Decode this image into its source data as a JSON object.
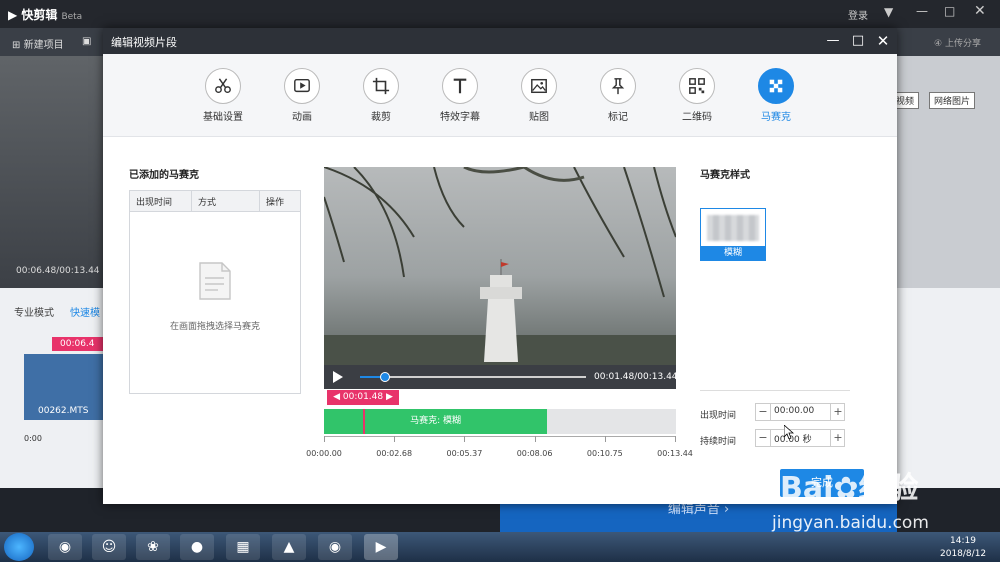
{
  "app": {
    "name": "快剪辑",
    "edition": "Beta",
    "login_label": "登录",
    "new_project_label": "新建项目",
    "upload_share_label": "上传分享",
    "preview_time": "00:06.48/00:13.44",
    "pro_mode_label": "专业模式",
    "quick_mode_label": "快速模",
    "clip_name": "00262.MTS",
    "clip_time": "00:06.4",
    "ruler_start": "0:00",
    "right_btn_1": "视频",
    "right_btn_2": "网络图片",
    "bottom_button_label": "编辑声音"
  },
  "modal": {
    "title": "编辑视频片段",
    "tools": [
      {
        "name": "basic",
        "label": "基础设置",
        "icon": "scissors-icon"
      },
      {
        "name": "animation",
        "label": "动画",
        "icon": "play-box-icon"
      },
      {
        "name": "crop",
        "label": "裁剪",
        "icon": "crop-icon"
      },
      {
        "name": "subtitle",
        "label": "特效字幕",
        "icon": "text-icon"
      },
      {
        "name": "sticker",
        "label": "贴图",
        "icon": "image-icon"
      },
      {
        "name": "mark",
        "label": "标记",
        "icon": "pin-icon"
      },
      {
        "name": "qrcode",
        "label": "二维码",
        "icon": "qrcode-icon"
      },
      {
        "name": "mosaic",
        "label": "马赛克",
        "icon": "mosaic-icon"
      }
    ],
    "added_panel": {
      "title": "已添加的马赛克",
      "columns": [
        "出现时间",
        "方式",
        "操作"
      ],
      "empty_hint": "在画面拖拽选择马赛克"
    },
    "video": {
      "current_time": "00:01.48/00:13.44",
      "progress": 0.11
    },
    "timeline": {
      "playhead_label": "00:01.48",
      "playhead_fraction": 0.11,
      "segment_label": "马赛克: 模糊",
      "segment_end_fraction": 0.634,
      "ticks": [
        "00:00.00",
        "00:02.68",
        "00:05.37",
        "00:08.06",
        "00:10.75",
        "00:13.44"
      ]
    },
    "style_panel": {
      "title": "马赛克样式",
      "selected_style": "模糊"
    },
    "fields": {
      "appear_label": "出现时间",
      "appear_value": "00:00.00",
      "duration_label": "持续时间",
      "duration_value": "00.00 秒"
    },
    "done_label": "完成"
  },
  "taskbar": {
    "time": "14:19",
    "date": "2018/8/12"
  },
  "watermark": {
    "brand": "Bai",
    "brand_cn": "经验",
    "url": "jingyan.baidu.com"
  },
  "colors": {
    "accent": "#1e88e5",
    "segment": "#31c46a",
    "playhead": "#e8336a"
  }
}
